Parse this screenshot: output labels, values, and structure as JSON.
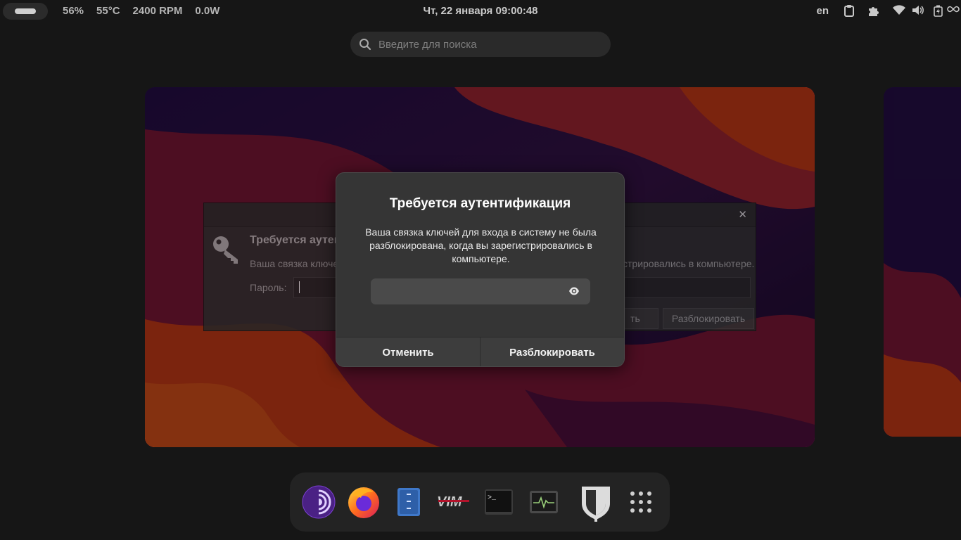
{
  "topbar": {
    "stats": [
      "56%",
      "55°C",
      "2400 RPM",
      "0.0W"
    ],
    "clock": "Чт, 22 января  09:00:48",
    "lang": "en",
    "tray_icons": [
      "clipboard-icon",
      "extensions-icon",
      "wifi-icon",
      "volume-icon",
      "battery-icon",
      "link-icon"
    ]
  },
  "search": {
    "placeholder": "Введите для поиска"
  },
  "background_window": {
    "title": "Требуется аутен",
    "message_left": "Ваша связка ключе",
    "message_right": "стрировались в компьютере.",
    "password_label": "Пароль:",
    "cancel_partial": "ть",
    "unlock_label": "Разблокировать"
  },
  "dialog": {
    "title": "Требуется аутентификация",
    "message": "Ваша связка ключей для входа в систему не была разблокирована, когда вы зарегистрировались в компьютере.",
    "password_value": "",
    "cancel_label": "Отменить",
    "unlock_label": "Разблокировать"
  },
  "dock": {
    "apps": [
      "tor-browser-icon",
      "firefox-icon",
      "file-manager-icon",
      "vim-icon",
      "terminal-icon",
      "system-monitor-icon",
      "keepassxc-icon",
      "app-grid-icon"
    ]
  },
  "colors": {
    "wallpaper_orange": "#e0431a",
    "wallpaper_purple": "#3b1650",
    "wallpaper_red": "#a8183b",
    "dialog_bg": "#353535"
  }
}
